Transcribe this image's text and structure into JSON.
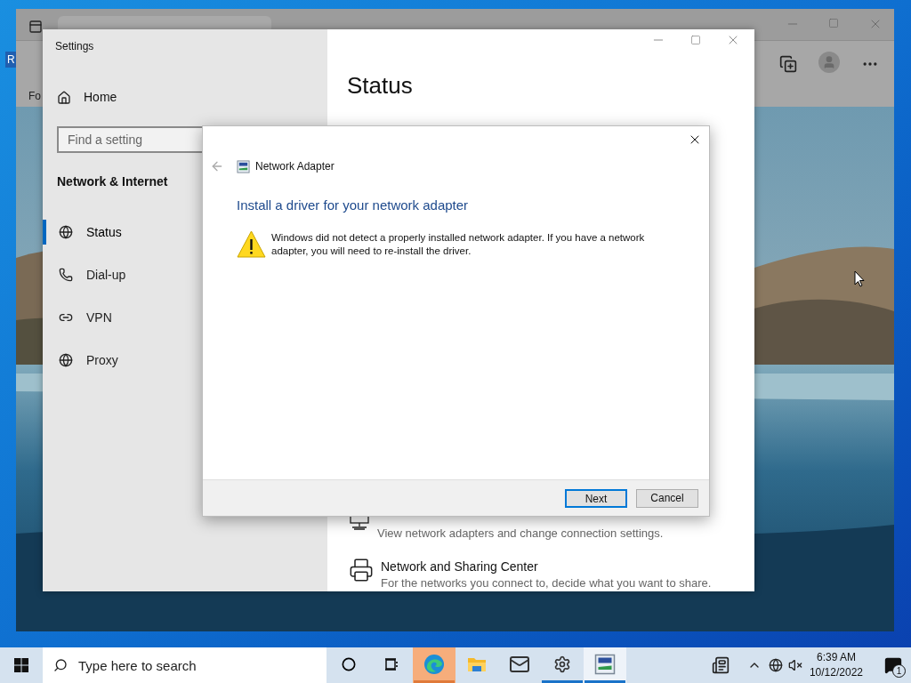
{
  "desktop": {
    "icon_labels": [
      "R"
    ]
  },
  "browser": {
    "favorites_bar": [
      "Fo"
    ]
  },
  "settings_window": {
    "title": "Settings",
    "home": "Home",
    "search": {
      "placeholder": "Find a setting"
    },
    "section": "Network & Internet",
    "nav": [
      {
        "label": "Status",
        "kind": "status",
        "selected": true
      },
      {
        "label": "Dial-up",
        "kind": "dialup",
        "selected": false
      },
      {
        "label": "VPN",
        "kind": "vpn",
        "selected": false
      },
      {
        "label": "Proxy",
        "kind": "proxy",
        "selected": false
      }
    ],
    "page_title": "Status",
    "links": [
      {
        "kind": "adapter",
        "description": "View network adapters and change connection settings."
      },
      {
        "kind": "sharing",
        "title": "Network and Sharing Center",
        "description": "For the networks you connect to, decide what you want to share."
      }
    ]
  },
  "dialog": {
    "title": "Network Adapter",
    "heading": "Install a driver for your network adapter",
    "message": "Windows did not detect a properly installed network adapter. If you have a network adapter, you will need to re-install the driver.",
    "buttons": [
      {
        "label": "Next",
        "default": true
      },
      {
        "label": "Cancel",
        "default": false
      }
    ]
  },
  "taskbar": {
    "search": {
      "placeholder": "Type here to search"
    },
    "apps": [
      {
        "kind": "cortana",
        "running": false,
        "focused": false,
        "flashing": false
      },
      {
        "kind": "taskview",
        "running": false,
        "focused": false,
        "flashing": false
      },
      {
        "kind": "edge",
        "running": true,
        "focused": false,
        "flashing": true
      },
      {
        "kind": "explorer",
        "running": false,
        "focused": false,
        "flashing": false
      },
      {
        "kind": "mail",
        "running": false,
        "focused": false,
        "flashing": false
      },
      {
        "kind": "settings",
        "running": true,
        "focused": false,
        "flashing": false
      },
      {
        "kind": "adapter",
        "running": true,
        "focused": true,
        "flashing": false
      }
    ],
    "clock": {
      "time": "6:39 AM",
      "date": "10/12/2022"
    },
    "notifications": "1"
  }
}
